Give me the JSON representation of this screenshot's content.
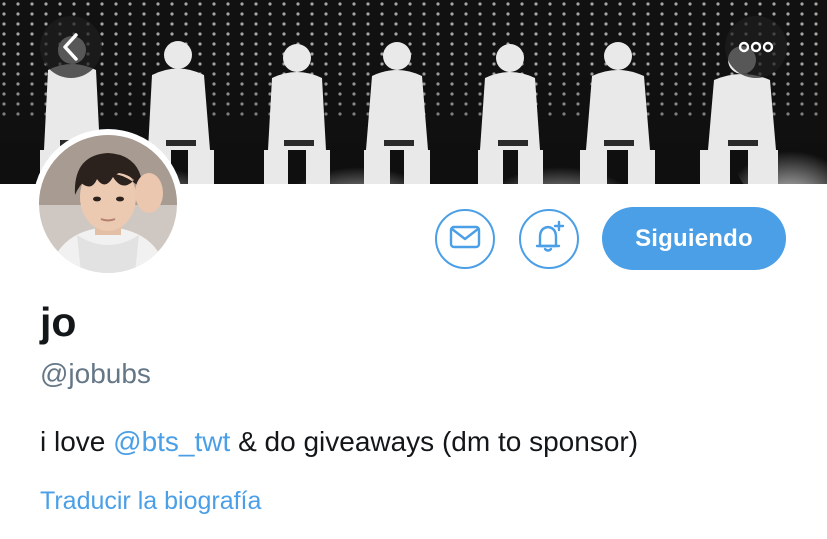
{
  "profile": {
    "display_name": "jo",
    "handle": "@jobubs",
    "bio": {
      "prefix": "i love ",
      "mention": "@bts_twt",
      "suffix": " & do giveaways (dm to sponsor)"
    },
    "translate_label": "Traducir la biografía"
  },
  "actions": {
    "follow_label": "Siguiendo",
    "message_icon": "envelope-icon",
    "notification_icon": "bell-plus-icon"
  },
  "header": {
    "back_icon": "chevron-left-icon",
    "more_icon": "ellipsis-icon"
  },
  "colors": {
    "accent": "#4a9fe6",
    "text": "#14171a",
    "secondary_text": "#657786",
    "banner_bg": "#0d0d0d"
  }
}
